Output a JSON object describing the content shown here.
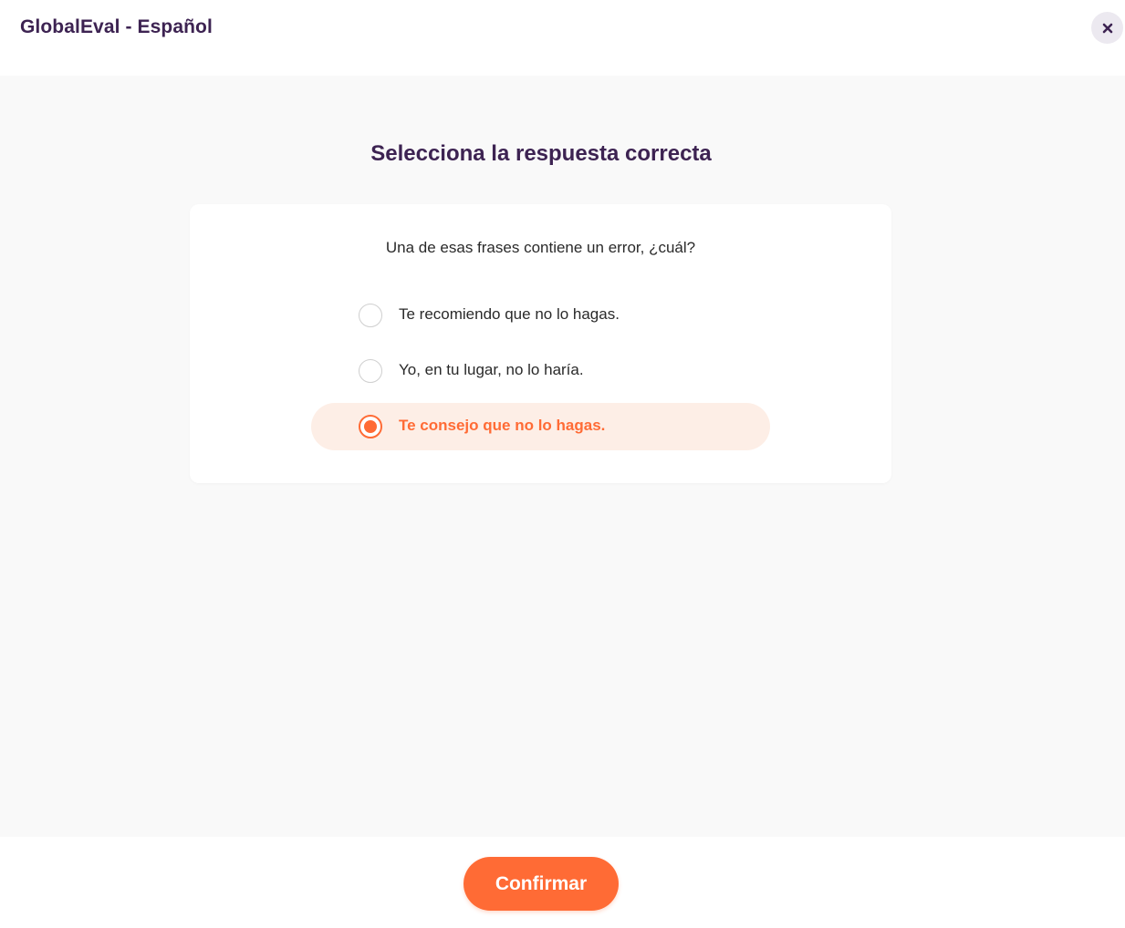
{
  "header": {
    "title": "GlobalEval - Español",
    "close_icon": "close-icon"
  },
  "main": {
    "title": "Selecciona la respuesta correcta",
    "prompt": "Una de esas frases contiene un error, ¿cuál?",
    "options": [
      {
        "label": "Te recomiendo que no lo hagas.",
        "selected": false
      },
      {
        "label": "Yo, en tu lugar, no lo haría.",
        "selected": false
      },
      {
        "label": "Te consejo que no lo hagas.",
        "selected": true
      }
    ]
  },
  "footer": {
    "confirm_label": "Confirmar"
  },
  "colors": {
    "accent": "#ff6b35",
    "title": "#3d2352",
    "selected_bg": "#fdeee6"
  }
}
